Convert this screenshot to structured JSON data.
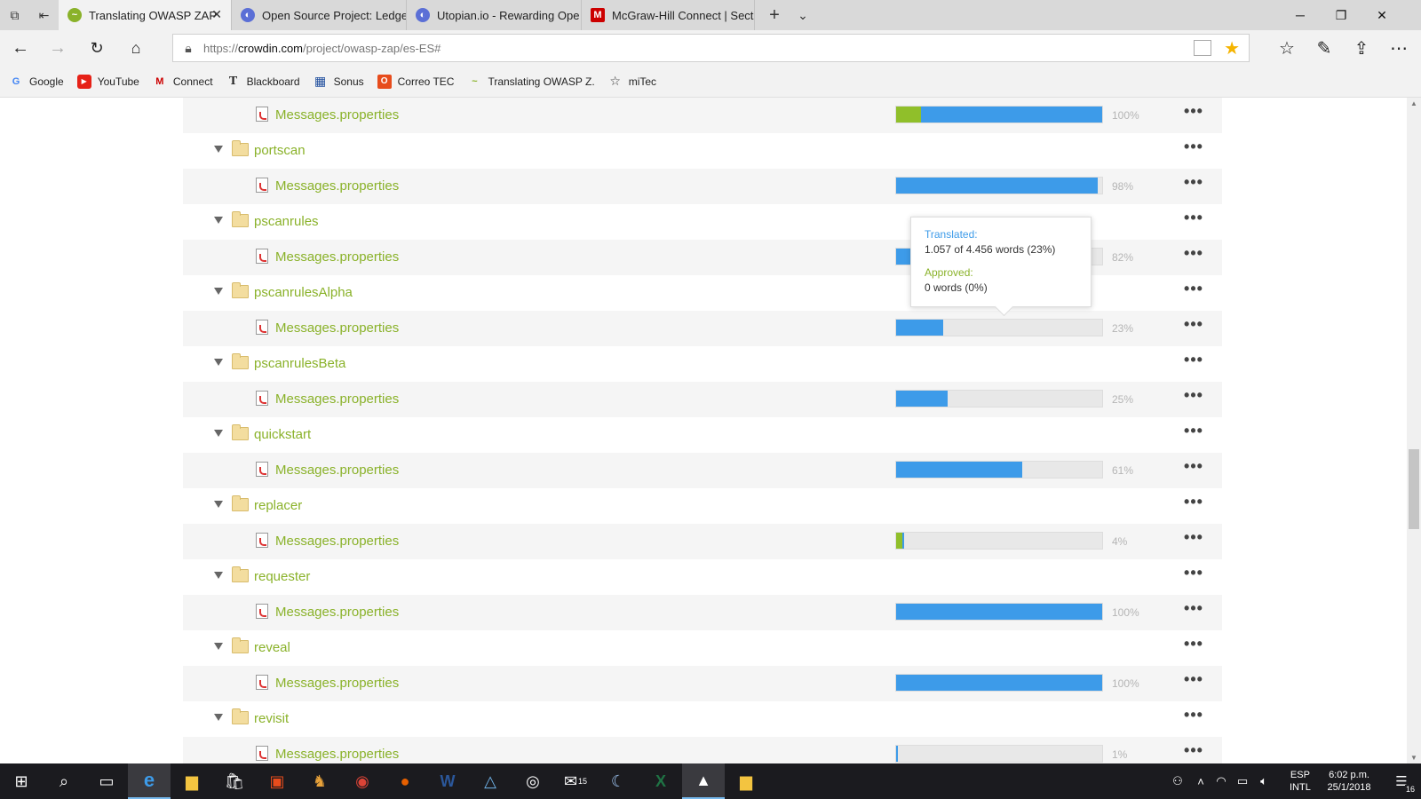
{
  "browser": {
    "tabs": [
      {
        "label": "Translating OWASP ZAP",
        "active": true,
        "icon": "crowdin-icon"
      },
      {
        "label": "Open Source Project: Ledge",
        "active": false,
        "icon": "utopian-icon"
      },
      {
        "label": "Utopian.io - Rewarding Ope",
        "active": false,
        "icon": "utopian-icon"
      },
      {
        "label": "McGraw-Hill Connect | Sect",
        "active": false,
        "icon": "mcgraw-hill-icon"
      }
    ],
    "url_prefix": "https://",
    "url_domain": "crowdin.com",
    "url_path": "/project/owasp-zap/es-ES#",
    "favorites": [
      {
        "label": "Google",
        "icon": "google-icon",
        "color": "#4285f4"
      },
      {
        "label": "YouTube",
        "icon": "youtube-icon",
        "color": "#e62117"
      },
      {
        "label": "Connect",
        "icon": "connect-icon",
        "color": "#cc0000"
      },
      {
        "label": "Blackboard",
        "icon": "blackboard-icon",
        "color": "#222222"
      },
      {
        "label": "Sonus",
        "icon": "sonus-icon",
        "color": "#1f4e9e"
      },
      {
        "label": "Correo TEC",
        "icon": "office-icon",
        "color": "#e74c1c"
      },
      {
        "label": "Translating OWASP Z.",
        "icon": "crowdin-icon",
        "color": "#8ab22a"
      },
      {
        "label": "miTec",
        "icon": "star-outline-icon",
        "color": "#333333"
      }
    ]
  },
  "rows": [
    {
      "kind": "file",
      "name": "Messages.properties",
      "approved": 12,
      "translated": 100,
      "pct": "100%"
    },
    {
      "kind": "folder",
      "name": "portscan"
    },
    {
      "kind": "file",
      "name": "Messages.properties",
      "approved": 0,
      "translated": 98,
      "pct": "98%"
    },
    {
      "kind": "folder",
      "name": "pscanrules"
    },
    {
      "kind": "file",
      "name": "Messages.properties",
      "approved": 0,
      "translated": 82,
      "pct": "82%"
    },
    {
      "kind": "folder",
      "name": "pscanrulesAlpha"
    },
    {
      "kind": "file",
      "name": "Messages.properties",
      "approved": 0,
      "translated": 23,
      "pct": "23%"
    },
    {
      "kind": "folder",
      "name": "pscanrulesBeta"
    },
    {
      "kind": "file",
      "name": "Messages.properties",
      "approved": 0,
      "translated": 25,
      "pct": "25%"
    },
    {
      "kind": "folder",
      "name": "quickstart"
    },
    {
      "kind": "file",
      "name": "Messages.properties",
      "approved": 0,
      "translated": 61,
      "pct": "61%"
    },
    {
      "kind": "folder",
      "name": "replacer"
    },
    {
      "kind": "file",
      "name": "Messages.properties",
      "approved": 3,
      "translated": 4,
      "pct": "4%"
    },
    {
      "kind": "folder",
      "name": "requester"
    },
    {
      "kind": "file",
      "name": "Messages.properties",
      "approved": 0,
      "translated": 100,
      "pct": "100%"
    },
    {
      "kind": "folder",
      "name": "reveal"
    },
    {
      "kind": "file",
      "name": "Messages.properties",
      "approved": 0,
      "translated": 100,
      "pct": "100%"
    },
    {
      "kind": "folder",
      "name": "revisit"
    },
    {
      "kind": "file",
      "name": "Messages.properties",
      "approved": 0,
      "translated": 1,
      "pct": "1%"
    }
  ],
  "more_label": "•••",
  "tooltip": {
    "translated_label": "Translated:",
    "translated_value": "1.057 of 4.456 words (23%)",
    "approved_label": "Approved:",
    "approved_value": "0 words (0%)"
  },
  "colors": {
    "translated": "#3d9be9",
    "approved": "#90bf2a",
    "link": "#8ab22a"
  },
  "taskbar": {
    "mail_badge": "15",
    "lang_top": "ESP",
    "lang_bottom": "INTL",
    "time": "6:02 p.m.",
    "date": "25/1/2018",
    "notifications": "16"
  }
}
